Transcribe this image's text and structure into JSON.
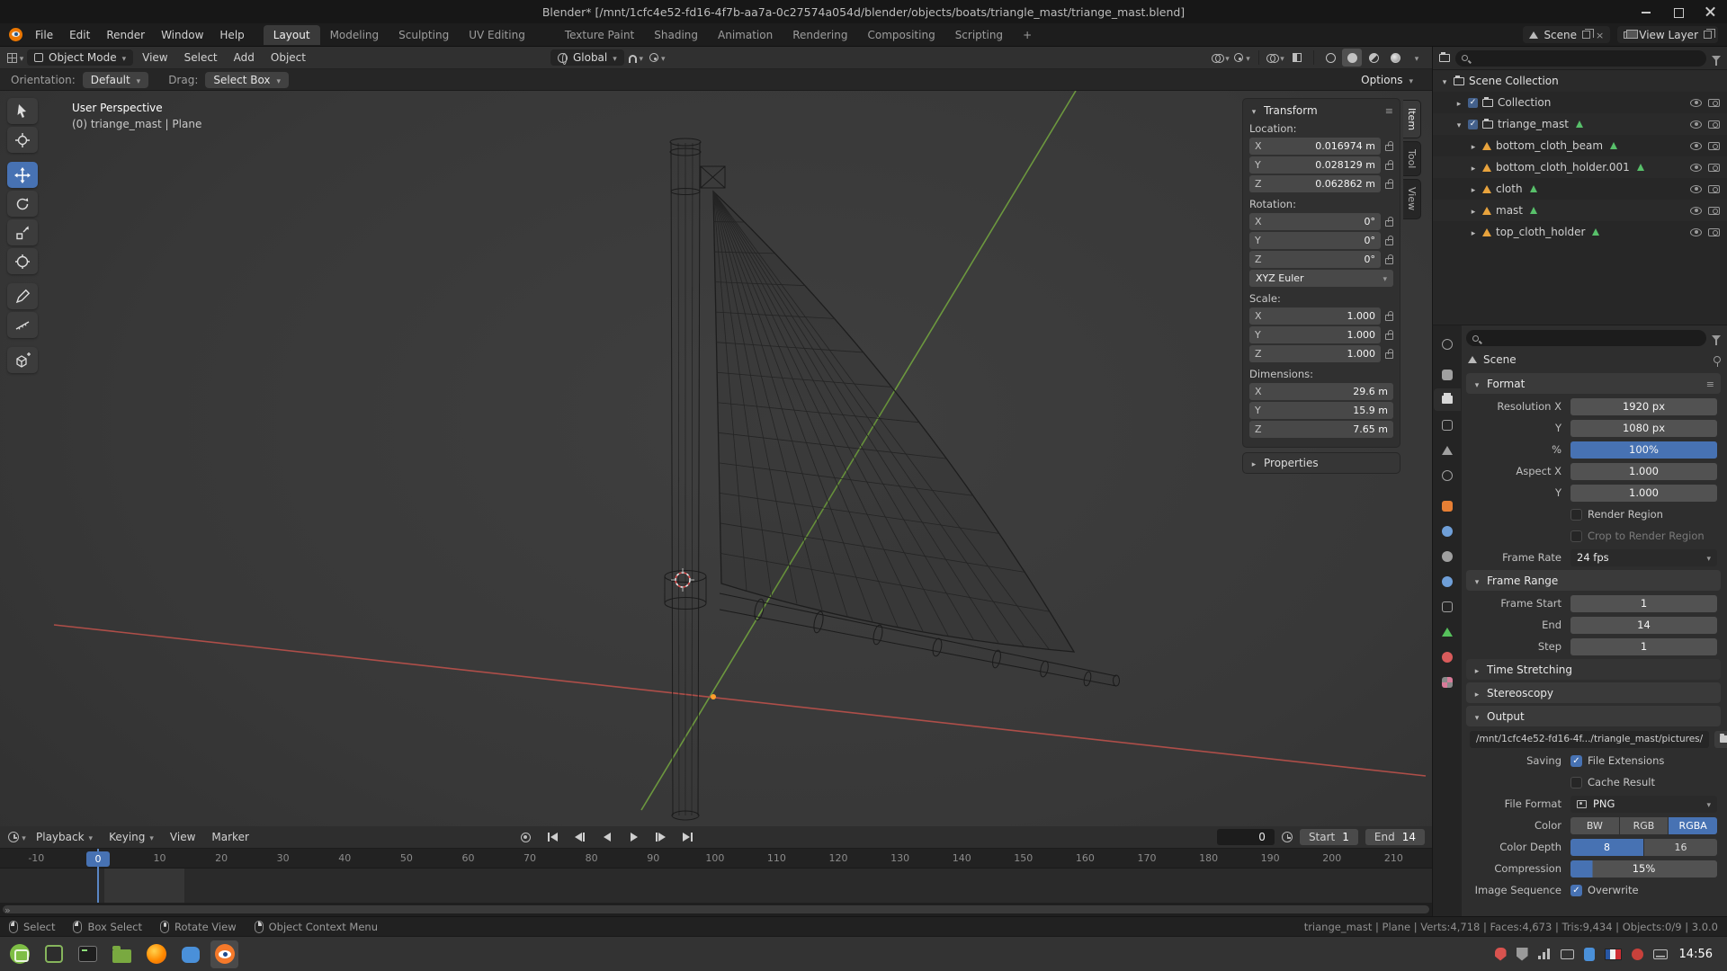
{
  "titlebar": {
    "title": "Blender* [/mnt/1cfc4e52-fd16-4f7b-aa7a-0c27574a054d/blender/objects/boats/triangle_mast/triange_mast.blend]"
  },
  "topbar": {
    "menus": [
      "File",
      "Edit",
      "Render",
      "Window",
      "Help"
    ],
    "workspaces": [
      "Layout",
      "Modeling",
      "Sculpting",
      "UV Editing",
      "Texture Paint",
      "Shading",
      "Animation",
      "Rendering",
      "Compositing",
      "Scripting"
    ],
    "active_workspace": "Layout",
    "add_workspace_label": "+",
    "scene_label": "Scene",
    "view_layer_label": "View Layer"
  },
  "viewport_header": {
    "mode": "Object Mode",
    "menu_view": "View",
    "menu_select": "Select",
    "menu_add": "Add",
    "menu_object": "Object",
    "orientation": "Global"
  },
  "tool_row": {
    "orientation_label": "Orientation:",
    "orientation_value": "Default",
    "drag_label": "Drag:",
    "drag_value": "Select Box",
    "options_label": "Options"
  },
  "viewport": {
    "perspective_label": "User Perspective",
    "object_label": "(0) triange_mast | Plane"
  },
  "n_panel": {
    "tab_item": "Item",
    "tab_tool": "Tool",
    "tab_view": "View",
    "transform_title": "Transform",
    "location_label": "Location:",
    "loc_x": "0.016974 m",
    "loc_y": "0.028129 m",
    "loc_z": "0.062862 m",
    "rotation_label": "Rotation:",
    "rot_x": "0°",
    "rot_y": "0°",
    "rot_z": "0°",
    "rotation_mode": "XYZ Euler",
    "scale_label": "Scale:",
    "scale_x": "1.000",
    "scale_y": "1.000",
    "scale_z": "1.000",
    "dimensions_label": "Dimensions:",
    "dim_x": "29.6 m",
    "dim_y": "15.9 m",
    "dim_z": "7.65 m",
    "properties_label": "Properties",
    "ax": "X",
    "ay": "Y",
    "az": "Z"
  },
  "outliner": {
    "rows": [
      {
        "label": "Scene Collection"
      },
      {
        "label": "Collection"
      },
      {
        "label": "triange_mast"
      },
      {
        "label": "bottom_cloth_beam"
      },
      {
        "label": "bottom_cloth_holder.001"
      },
      {
        "label": "cloth"
      },
      {
        "label": "mast"
      },
      {
        "label": "top_cloth_holder"
      }
    ]
  },
  "properties": {
    "breadcrumb": "Scene",
    "format_title": "Format",
    "resolution_x_label": "Resolution X",
    "resolution_x": "1920 px",
    "resolution_y_label": "Y",
    "resolution_y": "1080 px",
    "percent_label": "%",
    "percent_value": "100%",
    "aspect_x_label": "Aspect X",
    "aspect_x": "1.000",
    "aspect_y_label": "Y",
    "aspect_y": "1.000",
    "render_region_label": "Render Region",
    "crop_label": "Crop to Render Region",
    "frame_rate_label": "Frame Rate",
    "frame_rate": "24 fps",
    "frame_range_title": "Frame Range",
    "frame_start_label": "Frame Start",
    "frame_start": "1",
    "end_label": "End",
    "end": "14",
    "step_label": "Step",
    "step": "1",
    "time_stretching_label": "Time Stretching",
    "stereoscopy_label": "Stereoscopy",
    "output_title": "Output",
    "output_path": "/mnt/1cfc4e52-fd16-4f.../triangle_mast/pictures/",
    "saving_label": "Saving",
    "file_extensions_label": "File Extensions",
    "cache_result_label": "Cache Result",
    "file_format_label": "File Format",
    "file_format": "PNG",
    "color_label": "Color",
    "color_bw": "BW",
    "color_rgb": "RGB",
    "color_rgba": "RGBA",
    "color_depth_label": "Color Depth",
    "depth_8": "8",
    "depth_16": "16",
    "compression_label": "Compression",
    "compression": "15%",
    "image_sequence_label": "Image Sequence",
    "overwrite_label": "Overwrite"
  },
  "timeline": {
    "menu_playback": "Playback",
    "menu_keying": "Keying",
    "menu_view": "View",
    "menu_marker": "Marker",
    "current_frame": "0",
    "start_label": "Start",
    "start_value": "1",
    "end_label": "End",
    "end_value": "14",
    "ruler": [
      "-10",
      "0",
      "10",
      "20",
      "30",
      "40",
      "50",
      "60",
      "70",
      "80",
      "90",
      "100",
      "110",
      "120",
      "130",
      "140",
      "150",
      "160",
      "170",
      "180",
      "190",
      "200",
      "210"
    ]
  },
  "statusbar": {
    "select": "Select",
    "box_select": "Box Select",
    "rotate_view": "Rotate View",
    "context_menu": "Object Context Menu",
    "stats": "triange_mast | Plane | Verts:4,718 | Faces:4,673 | Tris:9,434 | Objects:0/9 | 3.0.0"
  },
  "taskbar": {
    "time": "14:56"
  }
}
